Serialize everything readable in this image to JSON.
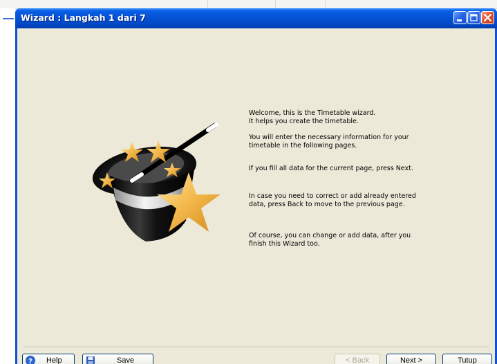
{
  "window": {
    "title": "Wizard : Langkah 1 dari 7"
  },
  "content": {
    "paragraphs": [
      [
        "Welcome, this is the Timetable wizard.",
        "It helps you create the timetable."
      ],
      [
        "You will enter the necessary information for your",
        "timetable in the following pages."
      ],
      [
        "If you fill all data for the current page, press Next."
      ],
      [
        "In case you need to correct or add already entered",
        "data, press Back to move to the previous page."
      ],
      [
        "Of course, you can change or add data, after you",
        "finish this Wizard too."
      ]
    ]
  },
  "buttons": {
    "help": "Help",
    "save": "Save",
    "back": "< Back",
    "next": "Next >",
    "close": "Tutup"
  },
  "icons": {
    "wizard": "magic-hat-icon",
    "help": "question-icon",
    "save": "floppy-disk-icon",
    "minimize": "minimize-icon",
    "maximize": "maximize-icon",
    "close": "close-icon"
  },
  "colors": {
    "titlebar": "#0553d6",
    "client_bg": "#ece9d8",
    "close_button": "#e0502c",
    "star": "#f3b84a"
  }
}
